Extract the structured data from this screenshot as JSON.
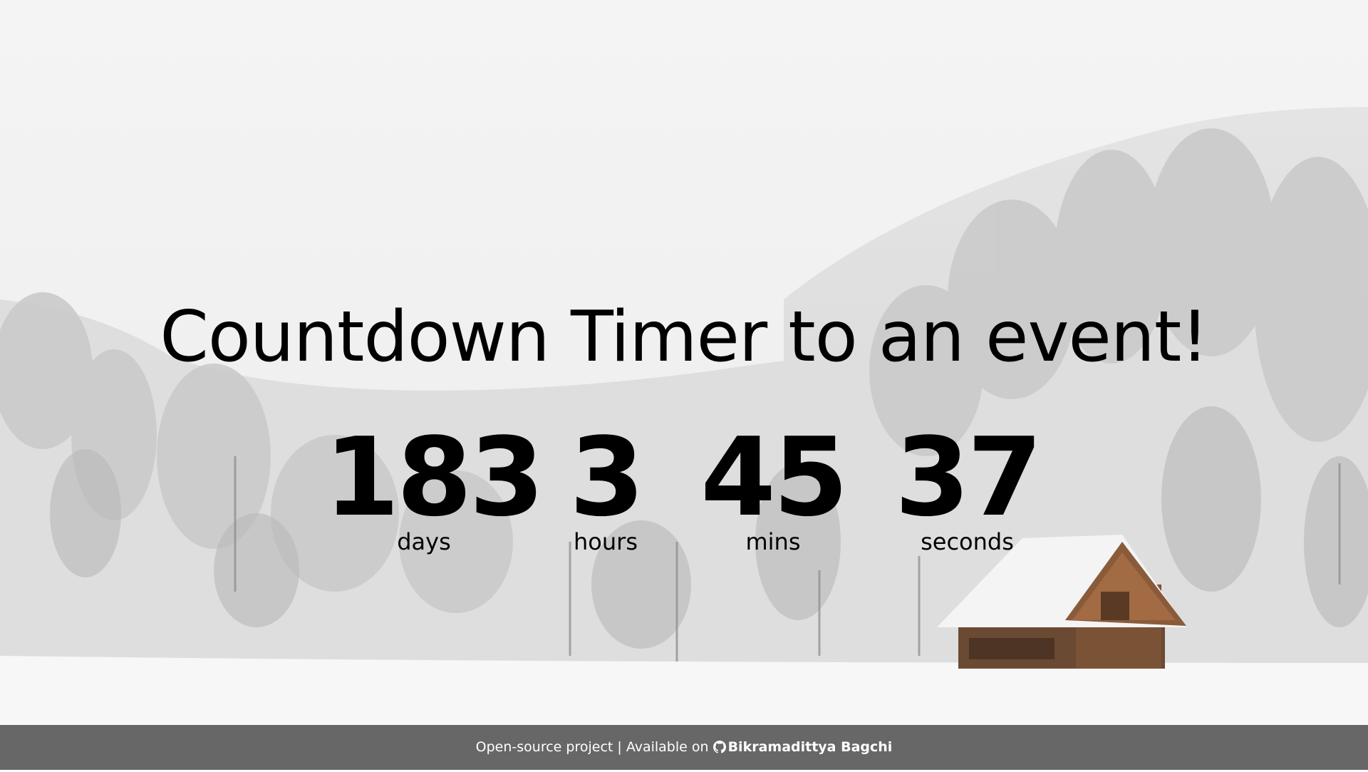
{
  "page": {
    "title": "Countdown Timer to an event!"
  },
  "countdown": [
    {
      "value": "183",
      "label": "days"
    },
    {
      "value": "3",
      "label": "hours"
    },
    {
      "value": "45",
      "label": "mins"
    },
    {
      "value": "37",
      "label": "seconds"
    }
  ],
  "footer": {
    "text": "Open-source project | Available on",
    "link_label": "Bikramadittya Bagchi",
    "link_icon": "github-icon"
  },
  "background": {
    "description_icon": "snowy-forest-background"
  }
}
